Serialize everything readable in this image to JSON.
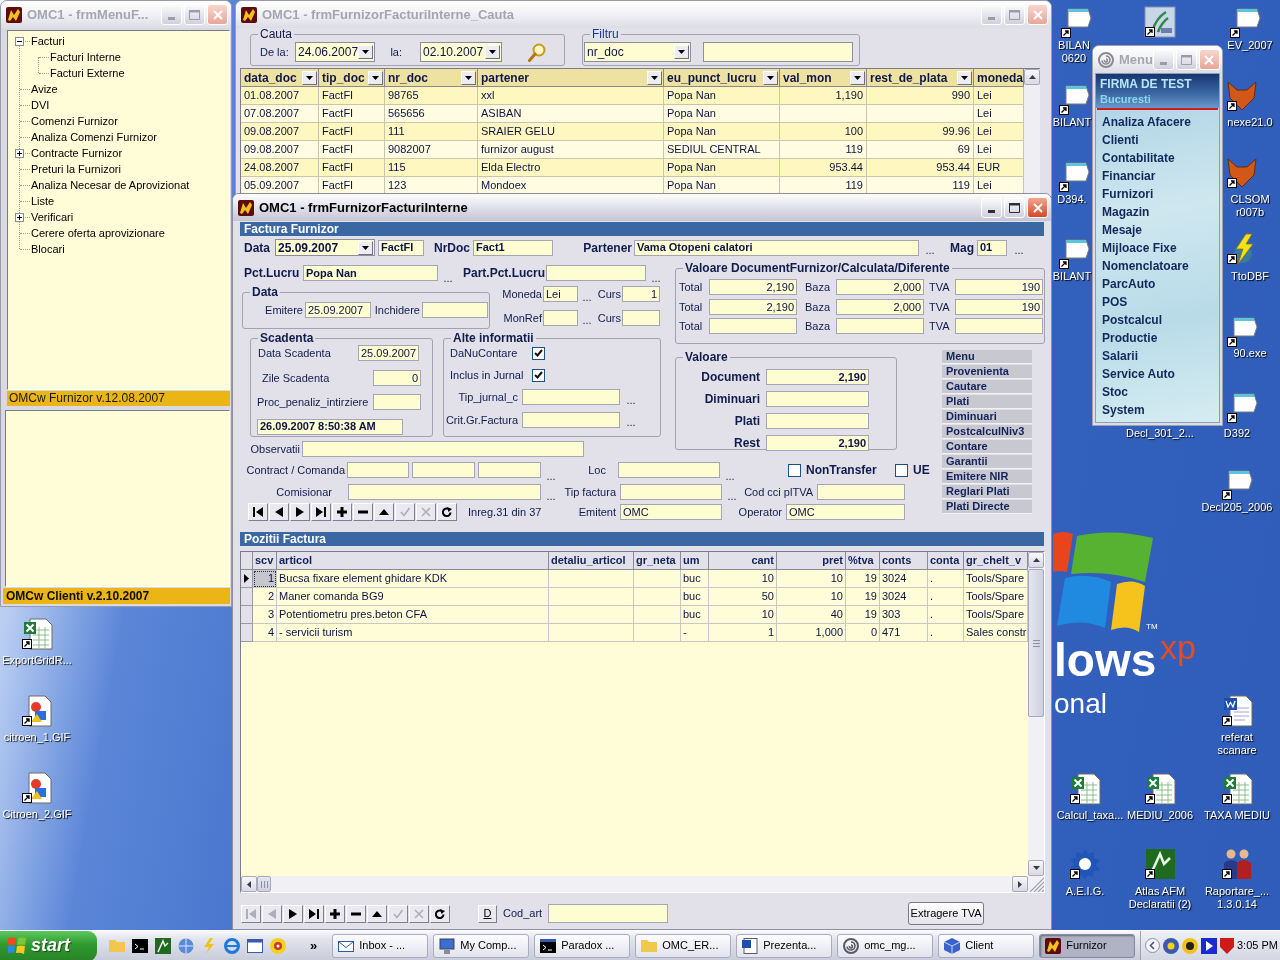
{
  "left_window": {
    "title": "OMC1 - frmMenuF...",
    "active": false,
    "tree": [
      {
        "label": "Facturi",
        "expandable": true,
        "expanded": true,
        "children": [
          {
            "label": "Facturi Interne",
            "expandable": false,
            "expanded": false
          },
          {
            "label": "Facturi Externe",
            "expandable": false,
            "expanded": false
          }
        ]
      },
      {
        "label": "Avize",
        "expandable": false,
        "expanded": false
      },
      {
        "label": "DVI",
        "expandable": false,
        "expanded": false
      },
      {
        "label": "Comenzi Furnizor",
        "expandable": false,
        "expanded": false
      },
      {
        "label": "Analiza Comenzi Furnizor",
        "expandable": false,
        "expanded": false
      },
      {
        "label": "Contracte Furnizor",
        "expandable": true,
        "expanded": false
      },
      {
        "label": "Preturi la Furnizori",
        "expandable": false,
        "expanded": false
      },
      {
        "label": "Analiza Necesar de Aprovizionat",
        "expandable": false,
        "expanded": false
      },
      {
        "label": "Liste",
        "expandable": false,
        "expanded": false
      },
      {
        "label": "Verificari",
        "expandable": true,
        "expanded": false
      },
      {
        "label": "Cerere oferta aprovizionare",
        "expandable": false,
        "expanded": false
      },
      {
        "label": "Blocari",
        "expandable": false,
        "expanded": false
      }
    ],
    "status": "OMCw Furnizor v.12.08.2007",
    "lower_status": "OMCw Clienti v.2.10.2007"
  },
  "search_window": {
    "title": "OMC1 - frmFurnizorFacturiInterne_Cauta",
    "active": false,
    "cauta": {
      "legend": "Cauta",
      "from_label": "De la:",
      "from": "24.06.2007",
      "to_label": "la:",
      "to": "02.10.2007"
    },
    "filtru": {
      "legend": "Filtru",
      "field": "nr_doc"
    },
    "grid": {
      "columns": [
        "data_doc",
        "tip_doc",
        "nr_doc",
        "partener",
        "eu_punct_lucru",
        "val_mon",
        "rest_de_plata",
        "moneda"
      ],
      "rows": [
        [
          "01.08.2007",
          "FactFI",
          "98765",
          "xxl",
          "Popa Nan",
          "1,190",
          "990",
          "Lei"
        ],
        [
          "07.08.2007",
          "FactFI",
          "565656",
          "ASIBAN",
          "Popa Nan",
          null,
          null,
          "Lei"
        ],
        [
          "09.08.2007",
          "FactFI",
          "111",
          "SRAIER GELU",
          "Popa Nan",
          "100",
          "99.96",
          "Lei"
        ],
        [
          "09.08.2007",
          "FactFI",
          "9082007",
          "furnizor august",
          "SEDIUL CENTRAL",
          "119",
          "69",
          "Lei"
        ],
        [
          "24.08.2007",
          "FactFI",
          "115",
          "Elda Electro",
          "Popa Nan",
          "953.44",
          "953.44",
          "EUR"
        ],
        [
          "05.09.2007",
          "FactFI",
          "123",
          "Mondoex",
          "Popa Nan",
          "119",
          "119",
          "Lei"
        ]
      ]
    }
  },
  "form_window": {
    "title": "OMC1 - frmFurnizorFacturiInterne",
    "active": true,
    "header": "Factura Furnizor",
    "row1": {
      "data": {
        "label": "Data",
        "value": "25.09.2007"
      },
      "tip": {
        "value": "FactFI"
      },
      "nrdoc": {
        "label": "NrDoc",
        "value": "Fact1"
      },
      "partener": {
        "label": "Partener",
        "value": "Vama Otopeni calatori",
        "lookup": "..."
      },
      "mag": {
        "label": "Mag",
        "value": "01",
        "lookup": "..."
      }
    },
    "pct_lucru": {
      "label": "Pct.Lucru",
      "value": "Popa Nan",
      "lookup": "..."
    },
    "part_pct_lucru": {
      "label": "Part.Pct.Lucru",
      "lookup": "..."
    },
    "data_group": {
      "legend": "Data",
      "emitere": {
        "label": "Emitere",
        "value": "25.09.2007"
      },
      "inchidere": {
        "label": "Inchidere"
      }
    },
    "moneda": {
      "label": "Moneda",
      "value": "Lei",
      "lookup": "...",
      "curs_label": "Curs",
      "curs": "1"
    },
    "monref": {
      "label": "MonRef",
      "lookup": "...",
      "curs_label": "Curs"
    },
    "scadenta": {
      "legend": "Scadenta",
      "data": {
        "label": "Data Scadenta",
        "value": "25.09.2007"
      },
      "zile": {
        "label": "Zile Scadenta",
        "value": "0"
      },
      "penalizare": {
        "label": "Proc_penaliz_intirziere"
      },
      "timestamp": "26.09.2007 8:50:38 AM"
    },
    "alte": {
      "legend": "Alte informatii",
      "checks": [
        {
          "label": "DaNuContare",
          "checked": true
        },
        {
          "label": "Inclus in Jurnal",
          "checked": true
        }
      ],
      "fields": [
        {
          "label": "Tip_jurnal_c",
          "lookup": "..."
        },
        {
          "label": "Crit.Gr.Factura",
          "lookup": "..."
        }
      ]
    },
    "valoare_doc": {
      "legend": "Valoare DocumentFurnizor/Calculata/Diferente",
      "rows": [
        {
          "total_label": "Total",
          "total": "2,190",
          "baza_label": "Baza",
          "baza": "2,000",
          "tva_label": "TVA",
          "tva": "190"
        },
        {
          "total_label": "Total",
          "total": "2,190",
          "baza_label": "Baza",
          "baza": "2,000",
          "tva_label": "TVA",
          "tva": "190"
        },
        {
          "total_label": "Total",
          "baza_label": "Baza",
          "tva_label": "TVA"
        }
      ]
    },
    "valoare": {
      "legend": "Valoare",
      "rows": [
        {
          "label": "Document",
          "value": "2,190"
        },
        {
          "label": "Diminuari"
        },
        {
          "label": "Plati"
        },
        {
          "label": "Rest",
          "value": "2,190"
        }
      ]
    },
    "side_buttons": [
      "Menu",
      "Provenienta",
      "Cautare",
      "Plati",
      "Diminuari",
      "PostcalculNiv3",
      "Contare",
      "Garantii",
      "Emitere NIR",
      "Reglari Plati",
      "Plati Directe"
    ],
    "observatii": {
      "label": "Observatii"
    },
    "contract": {
      "label": "Contract / Comanda",
      "lookup": "..."
    },
    "loc": {
      "label": "Loc",
      "lookup": "..."
    },
    "flags": [
      {
        "label": "NonTransfer",
        "checked": false
      },
      {
        "label": "UE",
        "checked": false
      }
    ],
    "comisionar": {
      "label": "Comisionar",
      "lookup": "..."
    },
    "tip_factura": {
      "label": "Tip factura",
      "lookup": "..."
    },
    "cod_cci": {
      "label": "Cod cci plTVA"
    },
    "navigator": [
      {
        "kind": "first",
        "disabled": false
      },
      {
        "kind": "prior",
        "disabled": false
      },
      {
        "kind": "next",
        "disabled": false
      },
      {
        "kind": "last",
        "disabled": false
      },
      {
        "kind": "insert",
        "disabled": false
      },
      {
        "kind": "delete",
        "disabled": false
      },
      {
        "kind": "edit",
        "disabled": false
      },
      {
        "kind": "post",
        "disabled": true
      },
      {
        "kind": "cancel",
        "disabled": true
      },
      {
        "kind": "refresh",
        "disabled": false
      }
    ],
    "record_info": "Inreg.31 din 37",
    "emitent": {
      "label": "Emitent",
      "value": "OMC"
    },
    "operator": {
      "label": "Operator",
      "value": "OMC"
    },
    "positions": {
      "header": "Pozitii Factura",
      "columns": [
        "scv",
        "articol",
        "detaliu_articol",
        "gr_neta",
        "um",
        "cant",
        "pret",
        "%tva",
        "conts",
        "conta",
        "gr_chelt_v"
      ],
      "rows": [
        {
          "selected": true,
          "cells": [
            "1",
            "Bucsa fixare element ghidare KDK",
            null,
            null,
            "buc",
            "10",
            "10",
            "19",
            "3024",
            ".",
            "Tools/Spare"
          ]
        },
        {
          "selected": false,
          "cells": [
            "2",
            "Maner comanda BG9",
            null,
            null,
            "buc",
            "50",
            "10",
            "19",
            "3024",
            ".",
            "Tools/Spare"
          ]
        },
        {
          "selected": false,
          "cells": [
            "3",
            "Potentiometru pres.beton CFA",
            null,
            null,
            "buc",
            "10",
            "40",
            "19",
            "303",
            ".",
            "Tools/Spare"
          ]
        },
        {
          "selected": false,
          "cells": [
            "4",
            "- servicii turism",
            null,
            null,
            "-",
            "1",
            "1,000",
            "0",
            "471",
            ".",
            "Sales constr"
          ]
        }
      ],
      "navigator": [
        {
          "kind": "first",
          "disabled": true
        },
        {
          "kind": "prior",
          "disabled": true
        },
        {
          "kind": "next",
          "disabled": false
        },
        {
          "kind": "last",
          "disabled": false
        },
        {
          "kind": "insert",
          "disabled": false
        },
        {
          "kind": "delete",
          "disabled": false
        },
        {
          "kind": "edit",
          "disabled": false
        },
        {
          "kind": "post",
          "disabled": true
        },
        {
          "kind": "cancel",
          "disabled": true
        },
        {
          "kind": "refresh",
          "disabled": false
        }
      ],
      "detail_button": "D",
      "cod_art_label": "Cod_art",
      "extract_button": "Extragere TVA"
    }
  },
  "menu_window": {
    "title": "Menu",
    "active": false,
    "company": "FIRMA DE TEST",
    "city": "Bucuresti",
    "items": [
      "Analiza Afacere",
      "Clienti",
      "Contabilitate",
      "Financiar",
      "Furnizori",
      "Magazin",
      "Mesaje",
      "Mijloace Fixe",
      "Nomenclatoare",
      "ParcAuto",
      "POS",
      "Postcalcul",
      "Productie",
      "Salarii",
      "Service Auto",
      "Stoc",
      "System"
    ]
  },
  "desktop": {
    "logo": {
      "word": "lows",
      "edition": "xp",
      "mark": "TM",
      "line2": "onal"
    },
    "icons": [
      {
        "label": "ExportGridR...",
        "kind": "spreadsheet"
      },
      {
        "label": "citroen_1.GIF",
        "kind": "image"
      },
      {
        "label": "Citroen_2.GIF",
        "kind": "image"
      },
      {
        "label": "BILAN\n0620",
        "kind": "file"
      },
      {
        "kind": "picture"
      },
      {
        "label": "EV_2007",
        "kind": "file"
      },
      {
        "label": "BILANT",
        "kind": "file"
      },
      {
        "label": "nexe21.0",
        "kind": "fox"
      },
      {
        "label": "D394.",
        "kind": "file"
      },
      {
        "label": "CLSOM\nr007b",
        "kind": "fox"
      },
      {
        "label": "BILANT",
        "kind": "file"
      },
      {
        "label": "TtoDBF",
        "kind": "lightning"
      },
      {
        "label": "90.exe",
        "kind": "file"
      },
      {
        "label": "Decl_301_2..."
      },
      {
        "label": "D392",
        "kind": "file"
      },
      {
        "label": "Decl205_2006",
        "kind": "file"
      },
      {
        "label": "referat\nscanare",
        "kind": "word"
      },
      {
        "label": "Calcul_taxa...",
        "kind": "spreadsheet"
      },
      {
        "label": "MEDIU_2006",
        "kind": "spreadsheet"
      },
      {
        "label": "TAXA MEDIU",
        "kind": "spreadsheet"
      },
      {
        "label": "A.E.I.G.",
        "kind": "gear"
      },
      {
        "label": "Atlas AFM\nDeclaratii (2)",
        "kind": "atlas"
      },
      {
        "label": "Raportare_...\n1.3.0.14",
        "kind": "people"
      }
    ]
  },
  "taskbar": {
    "start": "start",
    "more": "»",
    "tasks": [
      {
        "label": "Inbox - ...",
        "kind": "mail",
        "selected": false
      },
      {
        "label": "My Comp...",
        "kind": "computer",
        "selected": false
      },
      {
        "label": "Paradox ...",
        "kind": "console",
        "selected": false
      },
      {
        "label": "OMC_ER...",
        "kind": "folder",
        "selected": false
      },
      {
        "label": "Prezenta...",
        "kind": "document",
        "selected": false
      },
      {
        "label": "omc_mg...",
        "kind": "swirl",
        "selected": false
      },
      {
        "label": "Client",
        "kind": "cube",
        "selected": false
      },
      {
        "label": "Furnizor",
        "kind": "app",
        "selected": true
      }
    ],
    "clock": "3:05 PM"
  }
}
